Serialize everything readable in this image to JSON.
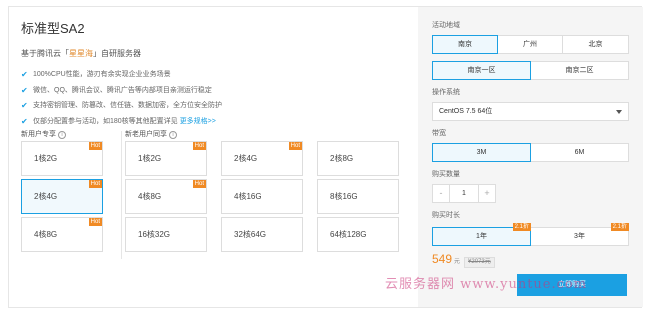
{
  "product": {
    "title": "标准型SA2",
    "subtitle_prefix": "基于腾讯云「",
    "subtitle_highlight": "星星海",
    "subtitle_suffix": "」自研服务器",
    "features": [
      "100%CPU性能，游刃有余实现企业业务场景",
      "微信、QQ、腾讯会议、腾讯广告等内部项目亲测运行稳定",
      "支持密钥管理、防篡改、信任链、数据加密，全方位安全防护",
      "仅部分配置参与活动，如180核等其他配置详见"
    ],
    "features_more": "更多规格>>"
  },
  "groups": {
    "new_user": "新用户专享",
    "old_user": "新老用户同享",
    "info_icon": "info-circle-icon"
  },
  "hot_label": "Hot",
  "cards": {
    "new": [
      {
        "label": "1核2G",
        "hot": true
      },
      {
        "label": "2核4G",
        "hot": true
      },
      {
        "label": "4核8G",
        "hot": true
      }
    ],
    "old": [
      {
        "label": "1核2G",
        "hot": true
      },
      {
        "label": "2核4G",
        "hot": true
      },
      {
        "label": "2核8G",
        "hot": false
      },
      {
        "label": "4核8G",
        "hot": true
      },
      {
        "label": "4核16G",
        "hot": false
      },
      {
        "label": "8核16G",
        "hot": false
      },
      {
        "label": "16核32G",
        "hot": false
      },
      {
        "label": "32核64G",
        "hot": false
      },
      {
        "label": "64核128G",
        "hot": false
      }
    ]
  },
  "config": {
    "region_label": "活动地域",
    "regions": [
      "南京",
      "广州",
      "北京"
    ],
    "zones": [
      "南京一区",
      "南京二区"
    ],
    "os_label": "操作系统",
    "os_value": "CentOS 7.5 64位",
    "bandwidth_label": "带宽",
    "bandwidths": [
      "3M",
      "6M"
    ],
    "qty_label": "购买数量",
    "qty_minus": "-",
    "qty_value": "1",
    "qty_plus": "+",
    "duration_label": "购买时长",
    "durations": [
      {
        "label": "1年",
        "badge": "2.1折"
      },
      {
        "label": "3年",
        "badge": "2.1折"
      }
    ],
    "price": "549",
    "price_unit": "元",
    "original_price": "¥2073元",
    "buy_label": "立即购买"
  },
  "watermark": "云服务器网 www.yuntue.com",
  "colors": {
    "accent": "#1ba0e2",
    "hot": "#f08a24",
    "panel": "#f5f5f5"
  }
}
